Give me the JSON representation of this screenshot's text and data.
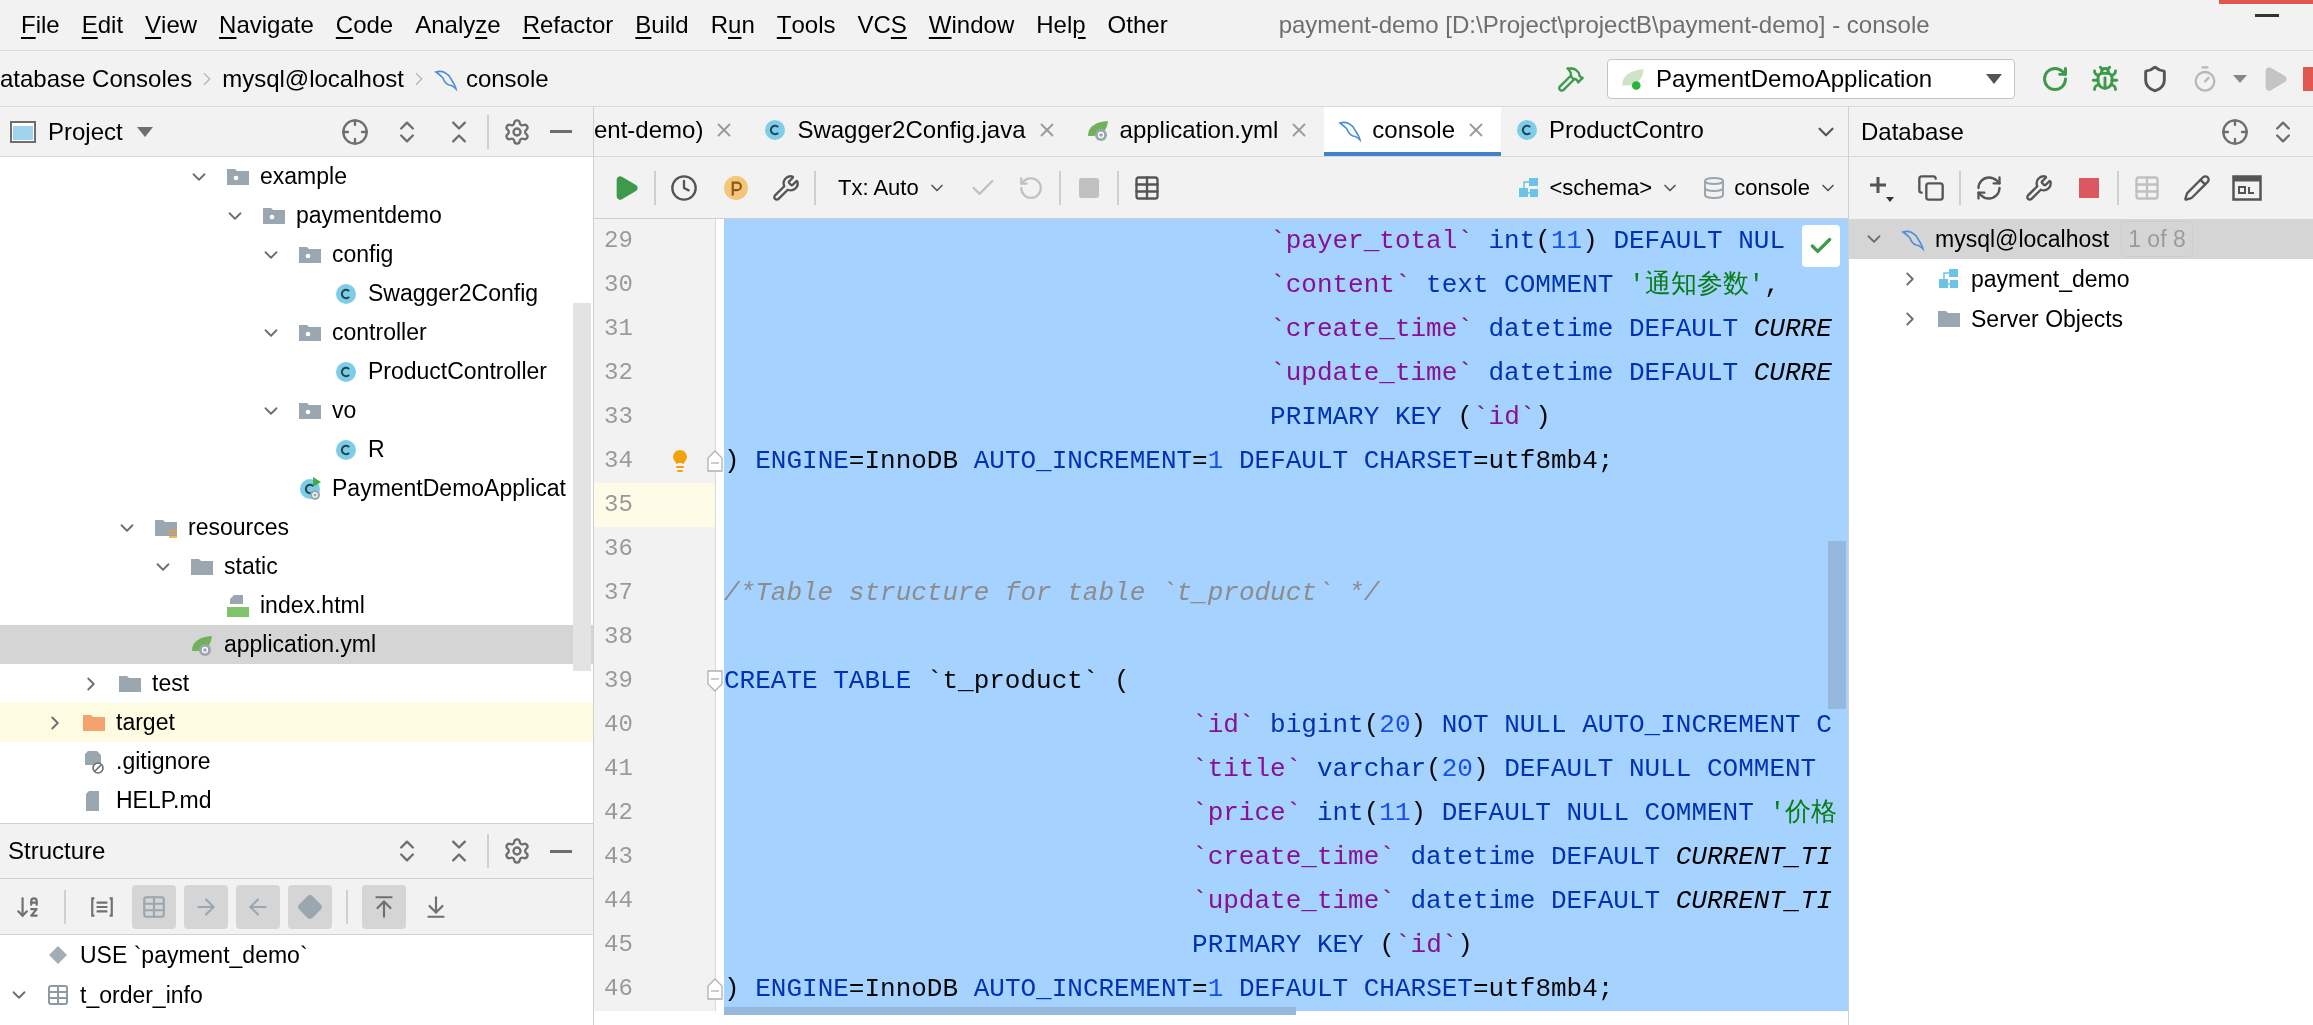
{
  "menu_bar": {
    "items": [
      {
        "key": "F",
        "post": "ile"
      },
      {
        "key": "E",
        "post": "dit"
      },
      {
        "key": "V",
        "post": "iew"
      },
      {
        "key": "N",
        "post": "avigate"
      },
      {
        "key": "C",
        "post": "ode"
      },
      {
        "pre": "Analy",
        "key": "z",
        "post": "e"
      },
      {
        "key": "R",
        "post": "efactor"
      },
      {
        "key": "B",
        "post": "uild"
      },
      {
        "pre": "R",
        "key": "u",
        "post": "n"
      },
      {
        "key": "T",
        "post": "ools"
      },
      {
        "pre": "VC",
        "key": "S"
      },
      {
        "key": "W",
        "post": "indow"
      },
      {
        "pre": "Hel",
        "key": "p"
      },
      {
        "pre": "Other"
      }
    ],
    "title": "payment-demo [D:\\Project\\projectB\\payment-demo] - console"
  },
  "navigation_bar": {
    "breadcrumbs": [
      {
        "label": "atabase Consoles",
        "kind": "plain"
      },
      {
        "label": "mysql@localhost",
        "kind": "plain"
      },
      {
        "label": "console",
        "kind": "console"
      }
    ],
    "run_configuration": "PaymentDemoApplication"
  },
  "project_panel": {
    "title": "Project",
    "tree": [
      {
        "label": "example",
        "kind": "package",
        "expanded": true,
        "selected": false,
        "ignored": false,
        "children": [
          {
            "label": "paymentdemo",
            "kind": "package",
            "expanded": true,
            "selected": false,
            "ignored": false,
            "children": [
              {
                "label": "config",
                "kind": "package",
                "expanded": true,
                "selected": false,
                "ignored": false,
                "children": [
                  {
                    "label": "Swagger2Config",
                    "kind": "class",
                    "selected": false,
                    "ignored": false
                  }
                ]
              },
              {
                "label": "controller",
                "kind": "package",
                "expanded": true,
                "selected": false,
                "ignored": false,
                "children": [
                  {
                    "label": "ProductController",
                    "kind": "class",
                    "selected": false,
                    "ignored": false
                  }
                ]
              },
              {
                "label": "vo",
                "kind": "package",
                "expanded": true,
                "selected": false,
                "ignored": false,
                "children": [
                  {
                    "label": "R",
                    "kind": "class",
                    "selected": false,
                    "ignored": false
                  }
                ]
              },
              {
                "label": "PaymentDemoApplicat",
                "kind": "application",
                "selected": false,
                "ignored": false
              }
            ]
          }
        ]
      },
      {
        "label": "resources",
        "kind": "resources",
        "expanded": true,
        "selected": false,
        "ignored": false,
        "children": [
          {
            "label": "static",
            "kind": "folder",
            "expanded": true,
            "selected": false,
            "ignored": false,
            "children": [
              {
                "label": "index.html",
                "kind": "html",
                "selected": false,
                "ignored": false
              }
            ]
          },
          {
            "label": "application.yml",
            "kind": "yaml",
            "selected": true,
            "ignored": false
          }
        ]
      },
      {
        "label": "test",
        "kind": "folder",
        "expanded": false,
        "selected": false,
        "ignored": false
      },
      {
        "label": "target",
        "kind": "output",
        "expanded": false,
        "selected": false,
        "ignored": true
      },
      {
        "label": ".gitignore",
        "kind": "ignore",
        "selected": false,
        "ignored": false
      },
      {
        "label": "HELP.md",
        "kind": "file",
        "selected": false,
        "ignored": false
      }
    ]
  },
  "editor_tabs": [
    {
      "label": "ent-demo)",
      "kind": "plain",
      "selected": false,
      "closable": true
    },
    {
      "label": "Swagger2Config.java",
      "kind": "class",
      "selected": false,
      "closable": true
    },
    {
      "label": "application.yml",
      "kind": "yaml",
      "selected": false,
      "closable": true
    },
    {
      "label": "console",
      "kind": "console",
      "selected": true,
      "closable": true
    },
    {
      "label": "ProductContro",
      "kind": "class",
      "selected": false,
      "closable": false
    }
  ],
  "editor_toolbar": {
    "transaction_mode": "Tx: Auto",
    "schema": "<schema>",
    "session": "console"
  },
  "editor": {
    "lines": [
      {
        "number": "29",
        "kind": "plain",
        "selected": true,
        "current": false,
        "bulb": false,
        "tokens": [
          {
            "kind": "identifier",
            "text": "                                   `payer_total` "
          },
          {
            "kind": "keyword",
            "text": "int"
          },
          {
            "kind": "plain",
            "text": "("
          },
          {
            "kind": "number",
            "text": "11"
          },
          {
            "kind": "plain",
            "text": ") "
          },
          {
            "kind": "keyword",
            "text": "DEFAULT NUL"
          }
        ]
      },
      {
        "number": "30",
        "kind": "plain",
        "selected": true,
        "current": false,
        "bulb": false,
        "tokens": [
          {
            "kind": "identifier",
            "text": "                                   `content` "
          },
          {
            "kind": "keyword",
            "text": "text COMMENT "
          },
          {
            "kind": "string",
            "text": "'通知参数'"
          },
          {
            "kind": "plain",
            "text": ","
          }
        ]
      },
      {
        "number": "31",
        "kind": "plain",
        "selected": true,
        "current": false,
        "bulb": false,
        "tokens": [
          {
            "kind": "identifier",
            "text": "                                   `create_time` "
          },
          {
            "kind": "keyword",
            "text": "datetime DEFAULT "
          },
          {
            "kind": "constant",
            "text": "CURRE"
          }
        ]
      },
      {
        "number": "32",
        "kind": "plain",
        "selected": true,
        "current": false,
        "bulb": false,
        "tokens": [
          {
            "kind": "identifier",
            "text": "                                   `update_time` "
          },
          {
            "kind": "keyword",
            "text": "datetime DEFAULT "
          },
          {
            "kind": "constant",
            "text": "CURRE"
          }
        ]
      },
      {
        "number": "33",
        "kind": "plain",
        "selected": true,
        "current": false,
        "bulb": false,
        "tokens": [
          {
            "kind": "keyword",
            "text": "                                   PRIMARY KEY"
          },
          {
            "kind": "plain",
            "text": " ("
          },
          {
            "kind": "identifier",
            "text": "`id`"
          },
          {
            "kind": "plain",
            "text": ")"
          }
        ]
      },
      {
        "number": "34",
        "kind": "fold-end",
        "selected": true,
        "current": false,
        "bulb": true,
        "tokens": [
          {
            "kind": "plain",
            "text": ") "
          },
          {
            "kind": "keyword",
            "text": "ENGINE"
          },
          {
            "kind": "plain",
            "text": "=InnoDB "
          },
          {
            "kind": "keyword",
            "text": "AUTO_INCREMENT"
          },
          {
            "kind": "plain",
            "text": "="
          },
          {
            "kind": "number",
            "text": "1"
          },
          {
            "kind": "keyword",
            "text": " DEFAULT CHARSET"
          },
          {
            "kind": "plain",
            "text": "=utf8mb4;"
          }
        ]
      },
      {
        "number": "35",
        "kind": "plain",
        "selected": true,
        "current": true,
        "bulb": false
      },
      {
        "number": "36",
        "kind": "plain",
        "selected": true,
        "current": false,
        "bulb": false
      },
      {
        "number": "37",
        "kind": "plain",
        "selected": true,
        "current": false,
        "bulb": false,
        "tokens": [
          {
            "kind": "comment",
            "text": "/*Table structure for table `t_product` */"
          }
        ]
      },
      {
        "number": "38",
        "kind": "plain",
        "selected": true,
        "current": false,
        "bulb": false
      },
      {
        "number": "39",
        "kind": "fold-start",
        "selected": true,
        "current": false,
        "bulb": false,
        "tokens": [
          {
            "kind": "keyword",
            "text": "CREATE TABLE"
          },
          {
            "kind": "plain",
            "text": " `t_product` ("
          }
        ]
      },
      {
        "number": "40",
        "kind": "plain",
        "selected": true,
        "current": false,
        "bulb": false,
        "tokens": [
          {
            "kind": "identifier",
            "text": "                              `id` "
          },
          {
            "kind": "keyword",
            "text": "bigint"
          },
          {
            "kind": "plain",
            "text": "("
          },
          {
            "kind": "number",
            "text": "20"
          },
          {
            "kind": "plain",
            "text": ") "
          },
          {
            "kind": "keyword",
            "text": "NOT NULL AUTO_INCREMENT C"
          }
        ]
      },
      {
        "number": "41",
        "kind": "plain",
        "selected": true,
        "current": false,
        "bulb": false,
        "tokens": [
          {
            "kind": "identifier",
            "text": "                              `title` "
          },
          {
            "kind": "keyword",
            "text": "varchar"
          },
          {
            "kind": "plain",
            "text": "("
          },
          {
            "kind": "number",
            "text": "20"
          },
          {
            "kind": "plain",
            "text": ") "
          },
          {
            "kind": "keyword",
            "text": "DEFAULT NULL COMMENT"
          }
        ]
      },
      {
        "number": "42",
        "kind": "plain",
        "selected": true,
        "current": false,
        "bulb": false,
        "tokens": [
          {
            "kind": "identifier",
            "text": "                              `price` "
          },
          {
            "kind": "keyword",
            "text": "int"
          },
          {
            "kind": "plain",
            "text": "("
          },
          {
            "kind": "number",
            "text": "11"
          },
          {
            "kind": "plain",
            "text": ") "
          },
          {
            "kind": "keyword",
            "text": "DEFAULT NULL COMMENT "
          },
          {
            "kind": "string",
            "text": "'价格"
          }
        ]
      },
      {
        "number": "43",
        "kind": "plain",
        "selected": true,
        "current": false,
        "bulb": false,
        "tokens": [
          {
            "kind": "identifier",
            "text": "                              `create_time` "
          },
          {
            "kind": "keyword",
            "text": "datetime DEFAULT "
          },
          {
            "kind": "constant",
            "text": "CURRENT_TI"
          }
        ]
      },
      {
        "number": "44",
        "kind": "plain",
        "selected": true,
        "current": false,
        "bulb": false,
        "tokens": [
          {
            "kind": "identifier",
            "text": "                              `update_time` "
          },
          {
            "kind": "keyword",
            "text": "datetime DEFAULT "
          },
          {
            "kind": "constant",
            "text": "CURRENT_TI"
          }
        ]
      },
      {
        "number": "45",
        "kind": "plain",
        "selected": true,
        "current": false,
        "bulb": false,
        "tokens": [
          {
            "kind": "keyword",
            "text": "                              PRIMARY KEY"
          },
          {
            "kind": "plain",
            "text": " ("
          },
          {
            "kind": "identifier",
            "text": "`id`"
          },
          {
            "kind": "plain",
            "text": ")"
          }
        ]
      },
      {
        "number": "46",
        "kind": "fold-end",
        "selected": true,
        "current": false,
        "bulb": false,
        "tokens": [
          {
            "kind": "plain",
            "text": ") "
          },
          {
            "kind": "keyword",
            "text": "ENGINE"
          },
          {
            "kind": "plain",
            "text": "=InnoDB "
          },
          {
            "kind": "keyword",
            "text": "AUTO_INCREMENT"
          },
          {
            "kind": "plain",
            "text": "="
          },
          {
            "kind": "number",
            "text": "1"
          },
          {
            "kind": "keyword",
            "text": " DEFAULT CHARSET"
          },
          {
            "kind": "plain",
            "text": "=utf8mb4;"
          }
        ]
      }
    ]
  },
  "structure_panel": {
    "title": "Structure",
    "tools": [
      {
        "kind": "sort",
        "on": false
      },
      {
        "kind": "fields",
        "on": false
      },
      {
        "kind": "table",
        "on": true
      },
      {
        "kind": "forward",
        "on": true
      },
      {
        "kind": "back",
        "on": true
      },
      {
        "kind": "diamond",
        "on": true
      },
      {
        "kind": "scroll-from",
        "on": true
      },
      {
        "kind": "scroll-to",
        "on": false
      }
    ],
    "items": [
      {
        "label": "USE `payment_demo`",
        "kind": "statement"
      },
      {
        "label": "t_order_info",
        "kind": "table",
        "expanded": true
      }
    ]
  },
  "database_panel": {
    "title": "Database",
    "tree": [
      {
        "label": "mysql@localhost",
        "badge": "1 of 8",
        "kind": "console",
        "expanded": true,
        "selected": true,
        "children": [
          {
            "label": "payment_demo",
            "kind": "schema",
            "expanded": false,
            "selected": false
          },
          {
            "label": "Server Objects",
            "kind": "folder",
            "expanded": false,
            "selected": false
          }
        ]
      }
    ]
  }
}
